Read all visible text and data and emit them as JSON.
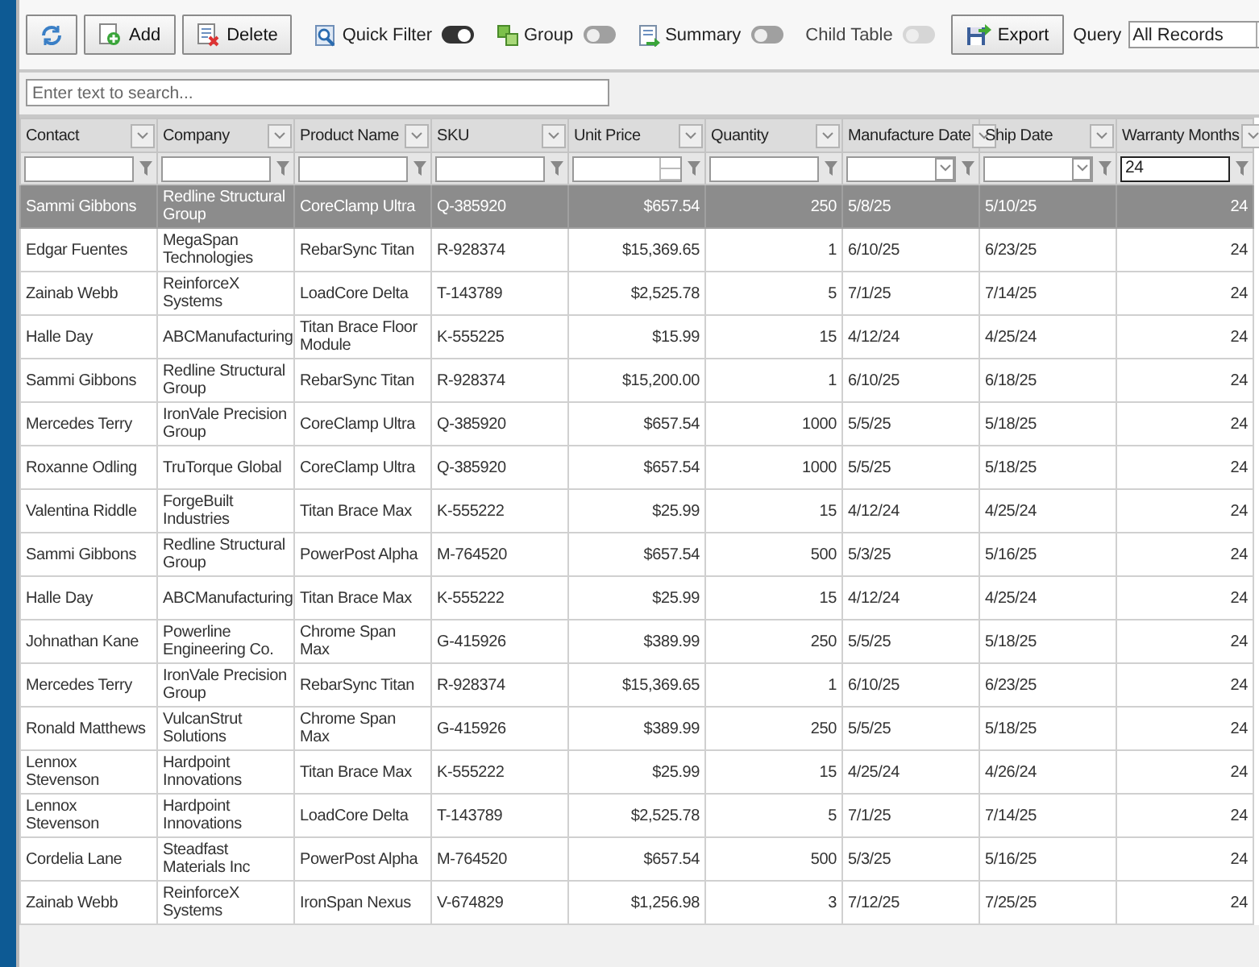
{
  "toolbar": {
    "buttons": [
      {
        "kind": "refresh"
      },
      {
        "kind": "add",
        "label": "Add"
      },
      {
        "kind": "delete",
        "label": "Delete"
      }
    ],
    "toggles": [
      {
        "kind": "filter",
        "label": "Quick Filter",
        "on": true,
        "disabled": false
      },
      {
        "kind": "group",
        "label": "Group",
        "on": false,
        "disabled": false
      },
      {
        "kind": "summary",
        "label": "Summary",
        "on": false,
        "disabled": false
      },
      {
        "kind": "none",
        "label": "Child Table",
        "on": false,
        "disabled": true
      }
    ],
    "export": {
      "label": "Export"
    },
    "query": {
      "label": "Query",
      "value": "All Records"
    }
  },
  "search": {
    "placeholder": "Enter text to search..."
  },
  "table": {
    "columns": [
      {
        "label": "Contact",
        "kind": "text"
      },
      {
        "label": "Company",
        "kind": "text"
      },
      {
        "label": "Product Name",
        "kind": "text"
      },
      {
        "label": "SKU",
        "kind": "text"
      },
      {
        "label": "Unit Price",
        "kind": "currency"
      },
      {
        "label": "Quantity",
        "kind": "number"
      },
      {
        "label": "Manufacture Date",
        "kind": "date"
      },
      {
        "label": "Ship Date",
        "kind": "date"
      },
      {
        "label": "Warranty Months",
        "kind": "number",
        "filter_value": "24"
      }
    ],
    "rows": [
      {
        "selected": true,
        "cells": [
          "Sammi Gibbons",
          "Redline Structural Group",
          "CoreClamp Ultra",
          "Q-385920",
          "$657.54",
          "250",
          "5/8/25",
          "5/10/25",
          "24"
        ]
      },
      {
        "selected": false,
        "cells": [
          "Edgar Fuentes",
          "MegaSpan Technologies",
          "RebarSync Titan",
          "R-928374",
          "$15,369.65",
          "1",
          "6/10/25",
          "6/23/25",
          "24"
        ]
      },
      {
        "selected": false,
        "cells": [
          "Zainab Webb",
          "ReinforceX Systems",
          "LoadCore Delta",
          "T-143789",
          "$2,525.78",
          "5",
          "7/1/25",
          "7/14/25",
          "24"
        ]
      },
      {
        "selected": false,
        "cells": [
          "Halle Day",
          "ABCManufacturing",
          "Titan Brace Floor Module",
          "K-555225",
          "$15.99",
          "15",
          "4/12/24",
          "4/25/24",
          "24"
        ]
      },
      {
        "selected": false,
        "cells": [
          "Sammi Gibbons",
          "Redline Structural Group",
          "RebarSync Titan",
          "R-928374",
          "$15,200.00",
          "1",
          "6/10/25",
          "6/18/25",
          "24"
        ]
      },
      {
        "selected": false,
        "cells": [
          "Mercedes Terry",
          "IronVale Precision Group",
          "CoreClamp Ultra",
          "Q-385920",
          "$657.54",
          "1000",
          "5/5/25",
          "5/18/25",
          "24"
        ]
      },
      {
        "selected": false,
        "cells": [
          "Roxanne Odling",
          "TruTorque Global",
          "CoreClamp Ultra",
          "Q-385920",
          "$657.54",
          "1000",
          "5/5/25",
          "5/18/25",
          "24"
        ]
      },
      {
        "selected": false,
        "cells": [
          "Valentina Riddle",
          "ForgeBuilt Industries",
          "Titan Brace Max",
          "K-555222",
          "$25.99",
          "15",
          "4/12/24",
          "4/25/24",
          "24"
        ]
      },
      {
        "selected": false,
        "cells": [
          "Sammi Gibbons",
          "Redline Structural Group",
          "PowerPost Alpha",
          "M-764520",
          "$657.54",
          "500",
          "5/3/25",
          "5/16/25",
          "24"
        ]
      },
      {
        "selected": false,
        "cells": [
          "Halle Day",
          "ABCManufacturing",
          "Titan Brace Max",
          "K-555222",
          "$25.99",
          "15",
          "4/12/24",
          "4/25/24",
          "24"
        ]
      },
      {
        "selected": false,
        "cells": [
          "Johnathan Kane",
          "Powerline Engineering Co.",
          "Chrome Span Max",
          "G-415926",
          "$389.99",
          "250",
          "5/5/25",
          "5/18/25",
          "24"
        ]
      },
      {
        "selected": false,
        "cells": [
          "Mercedes Terry",
          "IronVale Precision Group",
          "RebarSync Titan",
          "R-928374",
          "$15,369.65",
          "1",
          "6/10/25",
          "6/23/25",
          "24"
        ]
      },
      {
        "selected": false,
        "cells": [
          "Ronald Matthews",
          "VulcanStrut Solutions",
          "Chrome Span Max",
          "G-415926",
          "$389.99",
          "250",
          "5/5/25",
          "5/18/25",
          "24"
        ]
      },
      {
        "selected": false,
        "cells": [
          "Lennox Stevenson",
          "Hardpoint Innovations",
          "Titan Brace Max",
          "K-555222",
          "$25.99",
          "15",
          "4/25/24",
          "4/26/24",
          "24"
        ]
      },
      {
        "selected": false,
        "cells": [
          "Lennox Stevenson",
          "Hardpoint Innovations",
          "LoadCore Delta",
          "T-143789",
          "$2,525.78",
          "5",
          "7/1/25",
          "7/14/25",
          "24"
        ]
      },
      {
        "selected": false,
        "cells": [
          "Cordelia Lane",
          "Steadfast Materials Inc",
          "PowerPost Alpha",
          "M-764520",
          "$657.54",
          "500",
          "5/3/25",
          "5/16/25",
          "24"
        ]
      },
      {
        "selected": false,
        "cells": [
          "Zainab Webb",
          "ReinforceX Systems",
          "IronSpan Nexus",
          "V-674829",
          "$1,256.98",
          "3",
          "7/12/25",
          "7/25/25",
          "24"
        ]
      }
    ]
  }
}
